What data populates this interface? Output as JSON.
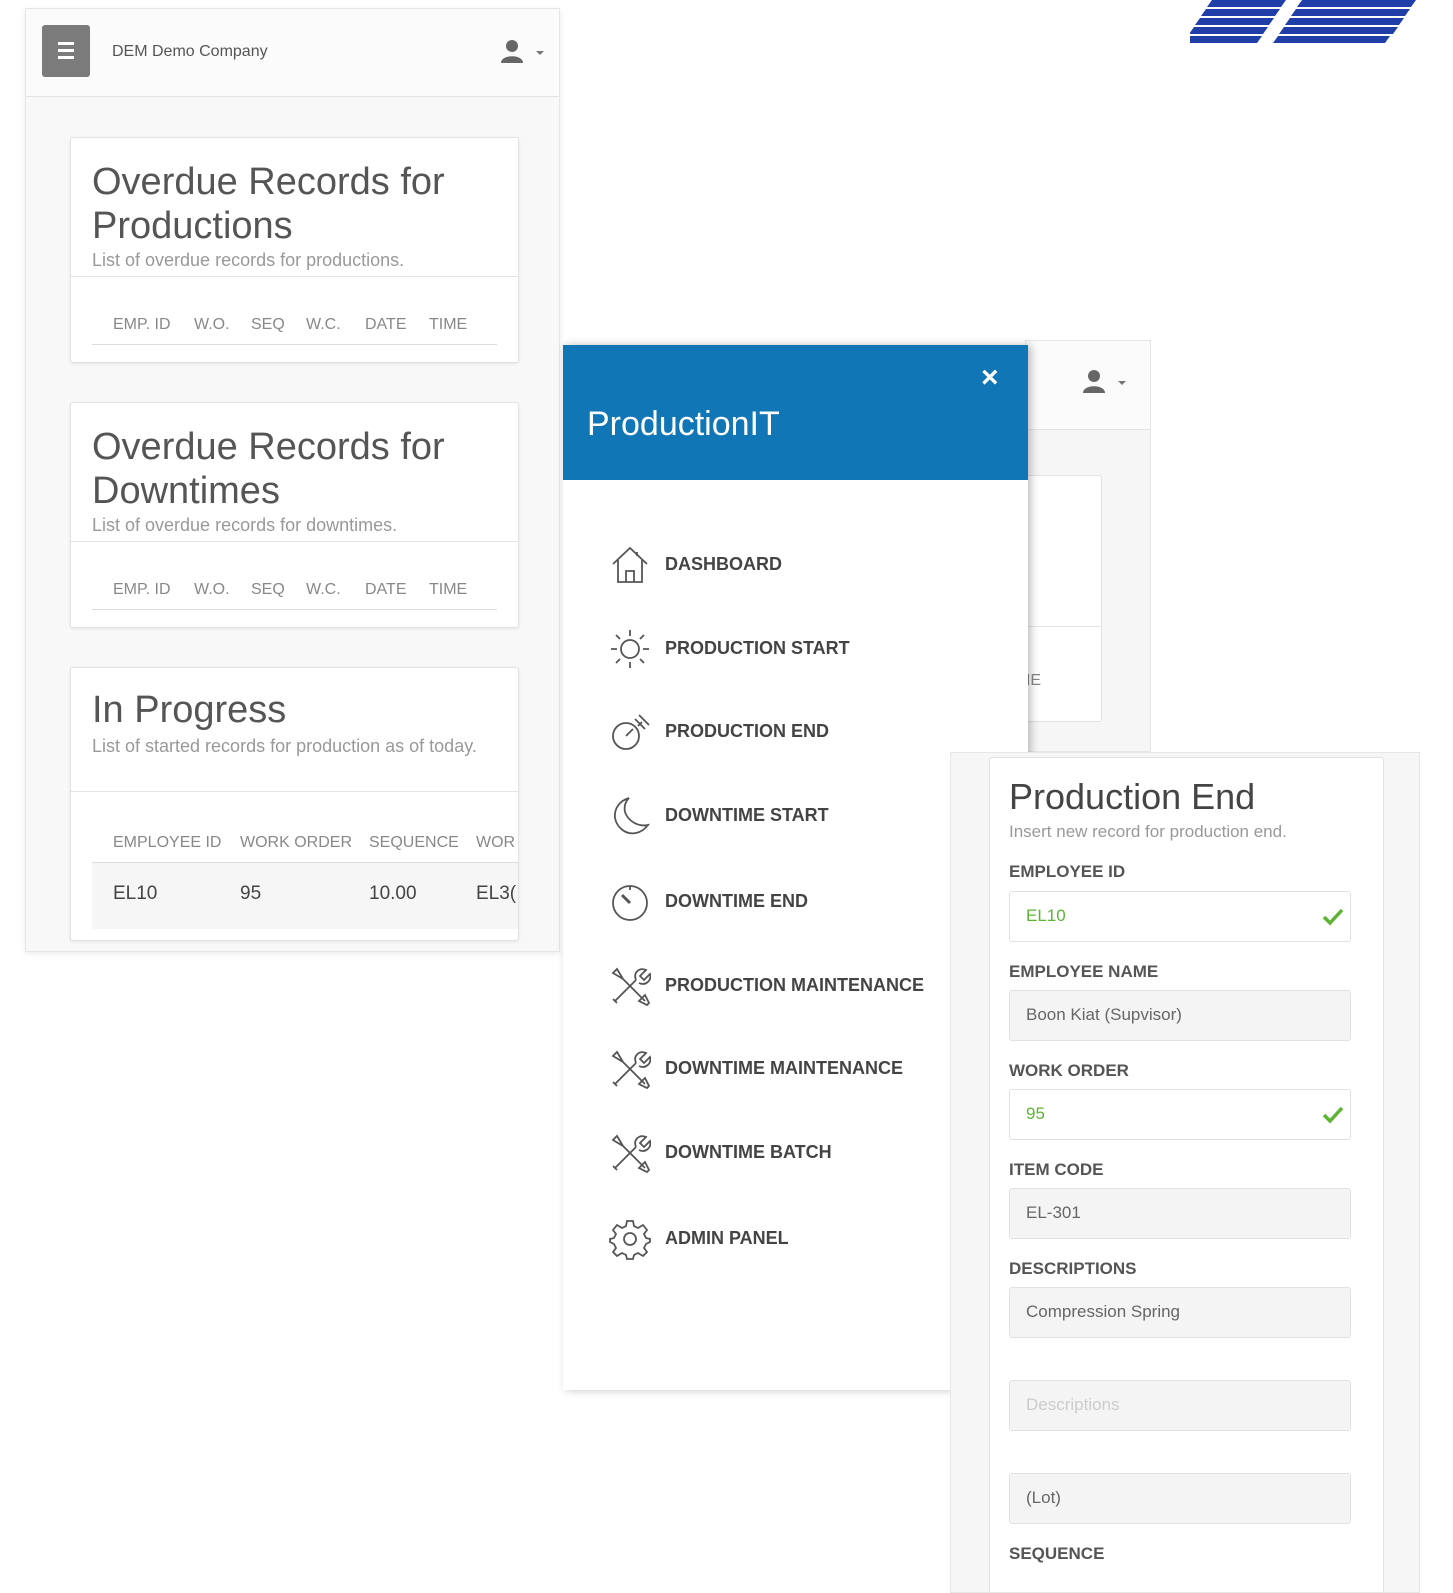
{
  "screen1": {
    "company": "DEM Demo Company",
    "cards": [
      {
        "title": "Overdue Records for Productions",
        "subtitle": "List of overdue records for productions.",
        "columns": [
          "EMP. ID",
          "W.O.",
          "SEQ",
          "W.C.",
          "DATE",
          "TIME"
        ]
      },
      {
        "title": "Overdue Records for Downtimes",
        "subtitle": "List of overdue records for downtimes.",
        "columns": [
          "EMP. ID",
          "W.O.",
          "SEQ",
          "W.C.",
          "DATE",
          "TIME"
        ]
      },
      {
        "title": "In Progress",
        "subtitle": "List of started records for production as of today.",
        "columns": [
          "EMPLOYEE ID",
          "WORK ORDER",
          "SEQUENCE",
          "WOR"
        ],
        "rows": [
          {
            "employee_id": "EL10",
            "work_order": "95",
            "sequence": "10.00",
            "work_center": "EL3("
          }
        ]
      }
    ]
  },
  "screen2": {
    "ghost_text": "ME"
  },
  "drawer": {
    "brand": "ProductionIT",
    "close": "×",
    "items": [
      {
        "label": "DASHBOARD",
        "icon": "home-icon"
      },
      {
        "label": "PRODUCTION START",
        "icon": "sun-icon"
      },
      {
        "label": "PRODUCTION END",
        "icon": "timer-icon"
      },
      {
        "label": "DOWNTIME START",
        "icon": "moon-icon"
      },
      {
        "label": "DOWNTIME END",
        "icon": "clock-icon"
      },
      {
        "label": "PRODUCTION MAINTENANCE",
        "icon": "tools-icon"
      },
      {
        "label": "DOWNTIME MAINTENANCE",
        "icon": "tools-icon"
      },
      {
        "label": "DOWNTIME BATCH",
        "icon": "tools-icon"
      },
      {
        "label": "ADMIN PANEL",
        "icon": "gear-icon"
      }
    ]
  },
  "form": {
    "title": "Production End",
    "subtitle": "Insert new record for production end.",
    "employee_id_label": "EMPLOYEE ID",
    "employee_id": "EL10",
    "employee_name_label": "EMPLOYEE NAME",
    "employee_name": "Boon Kiat (Supvisor)",
    "work_order_label": "WORK ORDER",
    "work_order": "95",
    "item_code_label": "ITEM CODE",
    "item_code": "EL-301",
    "descriptions_label": "DESCRIPTIONS",
    "descriptions": "Compression Spring",
    "descriptions_placeholder": "Descriptions",
    "lot_placeholder": "(Lot)",
    "sequence_label": "SEQUENCE"
  },
  "colors": {
    "brand_blue": "#1176b6",
    "valid_green": "#5cb432",
    "logo_blue": "#1f3ea8"
  }
}
